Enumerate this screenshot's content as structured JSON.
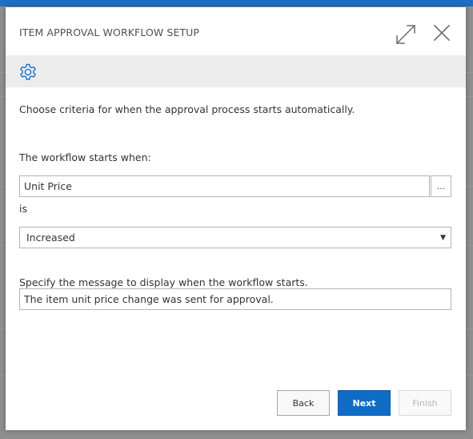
{
  "dialog": {
    "title": "ITEM APPROVAL WORKFLOW SETUP"
  },
  "header": {
    "expand_icon": "expand-icon",
    "close_icon": "close-icon"
  },
  "action_bar": {
    "settings_icon": "gear-icon"
  },
  "content": {
    "intro_text": "Choose criteria for when the approval process starts automatically.",
    "starts_when_label": "The workflow starts when:",
    "field_value": "Unit Price",
    "lookup_label": "...",
    "is_label": "is",
    "condition_value": "Increased",
    "message_label": "Specify the message to display when the workflow starts.",
    "message_value": "The item unit price change was sent for approval."
  },
  "footer": {
    "back_label": "Back",
    "next_label": "Next",
    "finish_label": "Finish"
  },
  "colors": {
    "accent": "#0f6cc4",
    "top_bar": "#1b70c5",
    "icon_blue": "#1a73c9"
  }
}
